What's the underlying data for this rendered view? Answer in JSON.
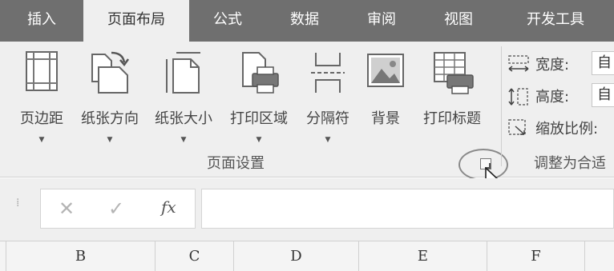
{
  "tabs": [
    "插入",
    "页面布局",
    "公式",
    "数据",
    "审阅",
    "视图",
    "开发工具"
  ],
  "active_tab": "页面布局",
  "page_setup": {
    "group_label": "页面设置",
    "buttons": [
      {
        "label": "页边距",
        "has_dropdown": true,
        "icon": "margins-icon"
      },
      {
        "label": "纸张方向",
        "has_dropdown": true,
        "icon": "orientation-icon"
      },
      {
        "label": "纸张大小",
        "has_dropdown": true,
        "icon": "paper-size-icon"
      },
      {
        "label": "打印区域",
        "has_dropdown": true,
        "icon": "print-area-icon"
      },
      {
        "label": "分隔符",
        "has_dropdown": true,
        "icon": "breaks-icon"
      },
      {
        "label": "背景",
        "has_dropdown": false,
        "icon": "background-icon"
      },
      {
        "label": "打印标题",
        "has_dropdown": false,
        "icon": "print-titles-icon"
      }
    ],
    "dropdown_glyph": "▼"
  },
  "scale_to_fit": {
    "group_label": "调整为合适",
    "width_label": "宽度:",
    "width_value": "自",
    "height_label": "高度:",
    "height_value": "自",
    "scale_label": "缩放比例:"
  },
  "formula_bar": {
    "cancel_glyph": "✕",
    "enter_glyph": "✓",
    "fx_label": "fx",
    "grip_glyph": "⁞",
    "value": ""
  },
  "columns": [
    "",
    "B",
    "C",
    "D",
    "E",
    "F",
    ""
  ],
  "colors": {
    "tab_bar": "#6f6f6f",
    "ribbon": "#efefef",
    "active_tab": "#efefef"
  }
}
